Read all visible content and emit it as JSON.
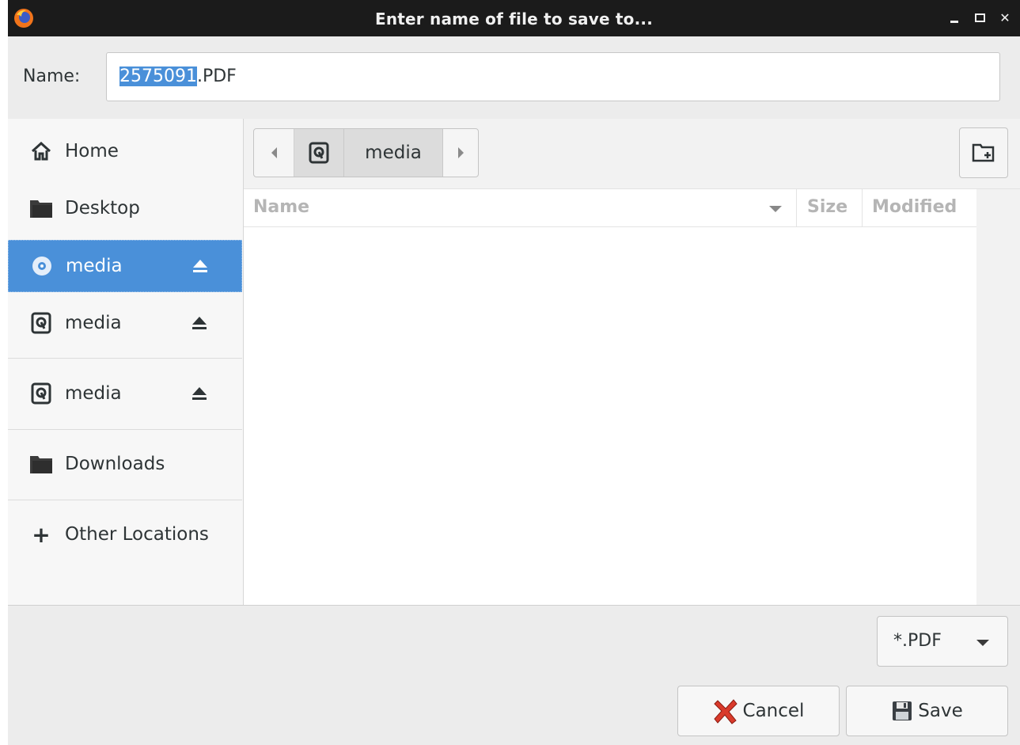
{
  "window": {
    "title": "Enter name of file to save to...",
    "controls": [
      "minimize",
      "maximize",
      "close"
    ],
    "close_glyph": "✕"
  },
  "name_field": {
    "label": "Name:",
    "value_selected": "2575091",
    "value_rest": ".PDF"
  },
  "sidebar": {
    "items": [
      {
        "label": "Home",
        "icon": "home-icon"
      },
      {
        "label": "Desktop",
        "icon": "folder-icon"
      },
      {
        "label": "media",
        "icon": "optical-disc-icon",
        "selected": true,
        "ejectable": true
      },
      {
        "label": "media",
        "icon": "drive-icon",
        "ejectable": true
      },
      {
        "label": "media",
        "icon": "drive-icon",
        "ejectable": true
      },
      {
        "label": "Downloads",
        "icon": "folder-icon"
      },
      {
        "label": "Other Locations",
        "icon": "plus-icon"
      }
    ],
    "plus_glyph": "+"
  },
  "pathbar": {
    "current": "media"
  },
  "file_list": {
    "columns": {
      "name": "Name",
      "size": "Size",
      "modified": "Modified"
    },
    "rows": []
  },
  "footer": {
    "filter_value": "*.PDF",
    "cancel_label": "Cancel",
    "save_label": "Save"
  },
  "colors": {
    "accent": "#4a90d9",
    "titlebar": "#1b1b1b"
  }
}
